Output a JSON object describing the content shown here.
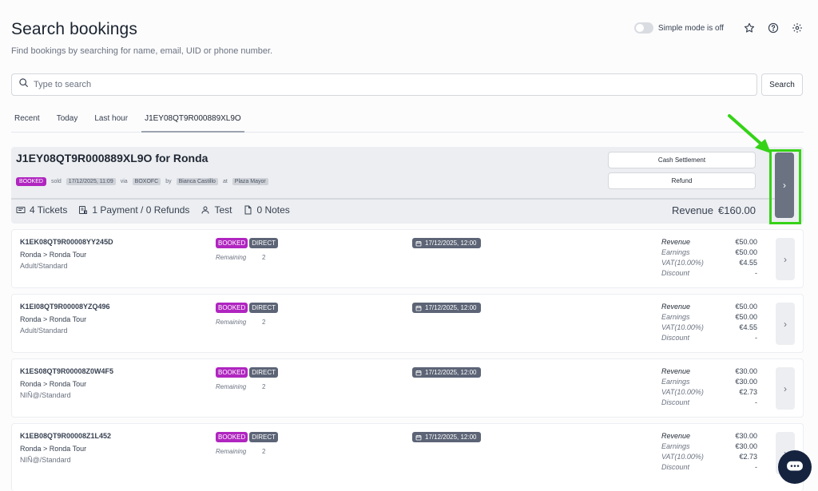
{
  "page": {
    "title": "Search bookings",
    "subtitle": "Find bookings by searching for name, email, UID or phone number."
  },
  "top_controls": {
    "simple_mode_label": "Simple mode is off",
    "simple_mode_on": false
  },
  "search": {
    "placeholder": "Type to search",
    "value": "",
    "button_label": "Search"
  },
  "tabs": [
    {
      "label": "Recent",
      "active": false
    },
    {
      "label": "Today",
      "active": false
    },
    {
      "label": "Last hour",
      "active": false
    },
    {
      "label": "J1EY08QT9R000889XL9O",
      "active": true
    }
  ],
  "booking": {
    "title": "J1EY08QT9R000889XL9O for Ronda",
    "status": "BOOKED",
    "sold_label": "sold",
    "sold_at": "17/12/2025, 11:09",
    "via_label": "via",
    "via": "BOXOFC",
    "by_label": "by",
    "by": "Bianca Castillo",
    "at_label": "at",
    "at": "Plaza Mayor",
    "actions": {
      "cash_settlement": "Cash Settlement",
      "refund": "Refund"
    },
    "stats": {
      "tickets": "4 Tickets",
      "payments": "1 Payment / 0 Refunds",
      "customer": "Test",
      "notes": "0 Notes"
    },
    "revenue_label": "Revenue",
    "revenue_value": "€160.00"
  },
  "tickets": [
    {
      "code": "K1EK08QT9R00008YY245D",
      "route": "Ronda > Ronda Tour",
      "type": "Adult/Standard",
      "status": "BOOKED",
      "channel": "DIRECT",
      "remaining_label": "Remaining",
      "remaining": "2",
      "date": "17/12/2025, 12:00",
      "revenue_label": "Revenue",
      "revenue": "€50.00",
      "earnings_label": "Earnings",
      "earnings": "€50.00",
      "vat_label": "VAT(10.00%)",
      "vat": "€4.55",
      "discount_label": "Discount",
      "discount": "-"
    },
    {
      "code": "K1EI08QT9R00008YZQ496",
      "route": "Ronda > Ronda Tour",
      "type": "Adult/Standard",
      "status": "BOOKED",
      "channel": "DIRECT",
      "remaining_label": "Remaining",
      "remaining": "2",
      "date": "17/12/2025, 12:00",
      "revenue_label": "Revenue",
      "revenue": "€50.00",
      "earnings_label": "Earnings",
      "earnings": "€50.00",
      "vat_label": "VAT(10.00%)",
      "vat": "€4.55",
      "discount_label": "Discount",
      "discount": "-"
    },
    {
      "code": "K1ES08QT9R00008Z0W4F5",
      "route": "Ronda > Ronda Tour",
      "type": "NIÑ@/Standard",
      "status": "BOOKED",
      "channel": "DIRECT",
      "remaining_label": "Remaining",
      "remaining": "2",
      "date": "17/12/2025, 12:00",
      "revenue_label": "Revenue",
      "revenue": "€30.00",
      "earnings_label": "Earnings",
      "earnings": "€30.00",
      "vat_label": "VAT(10.00%)",
      "vat": "€2.73",
      "discount_label": "Discount",
      "discount": "-"
    },
    {
      "code": "K1EB08QT9R00008Z1L452",
      "route": "Ronda > Ronda Tour",
      "type": "NIÑ@/Standard",
      "status": "BOOKED",
      "channel": "DIRECT",
      "remaining_label": "Remaining",
      "remaining": "2",
      "date": "17/12/2025, 12:00",
      "revenue_label": "Revenue",
      "revenue": "€30.00",
      "earnings_label": "Earnings",
      "earnings": "€30.00",
      "vat_label": "VAT(10.00%)",
      "vat": "€2.73",
      "discount_label": "Discount",
      "discount": "-"
    }
  ],
  "colors": {
    "booked": "#b025c0",
    "direct": "#5c6476",
    "highlight": "#35d317",
    "chat": "#15233f"
  },
  "icons": {
    "search": "search-icon",
    "star": "star-icon",
    "help": "help-icon",
    "settings": "gear-icon",
    "tickets": "ticket-icon",
    "payments": "payment-icon",
    "customer": "user-icon",
    "notes": "note-icon",
    "calendar": "calendar-icon",
    "chevron": "chevron-right-icon",
    "chat": "chat-icon",
    "annotation_arrow": "arrow-icon"
  }
}
